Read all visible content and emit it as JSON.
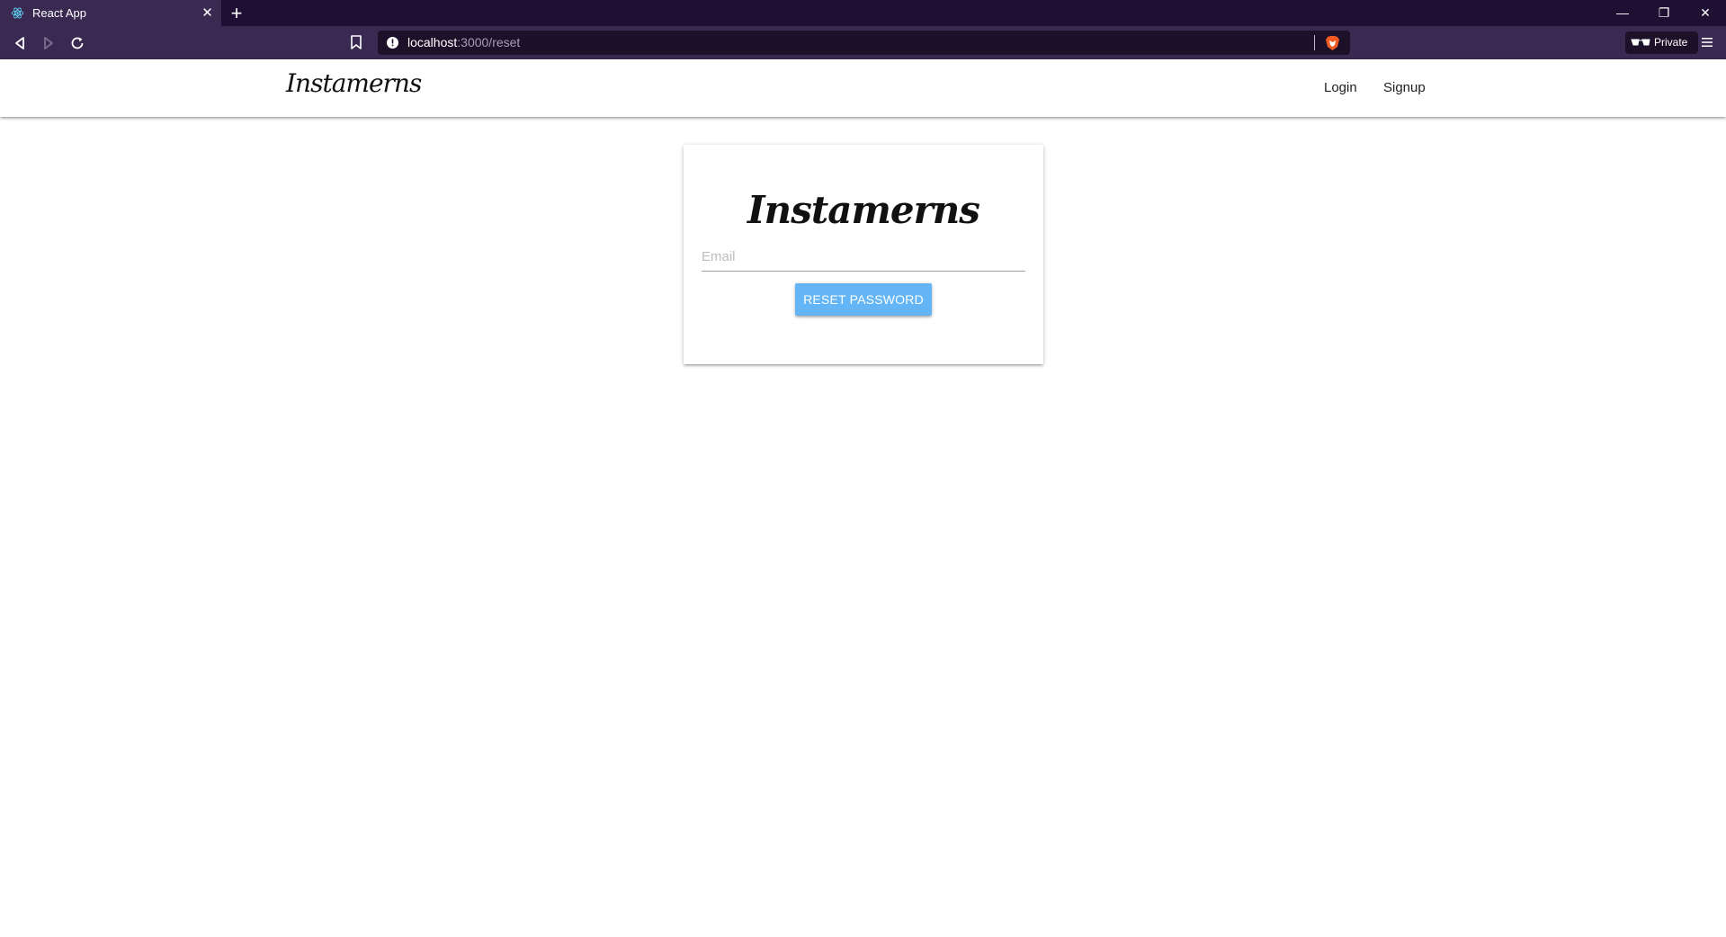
{
  "browser": {
    "tab_title": "React App",
    "url_host": "localhost",
    "url_path": ":3000/reset",
    "private_label": "Private",
    "accent_color": "#1f1033"
  },
  "navbar": {
    "brand": "Instamerns",
    "links": [
      "Login",
      "Signup"
    ]
  },
  "card": {
    "brand": "Instamerns",
    "email_placeholder": "Email",
    "email_value": "",
    "button_label": "RESET PASSWORD",
    "button_color": "#64b5f6"
  }
}
